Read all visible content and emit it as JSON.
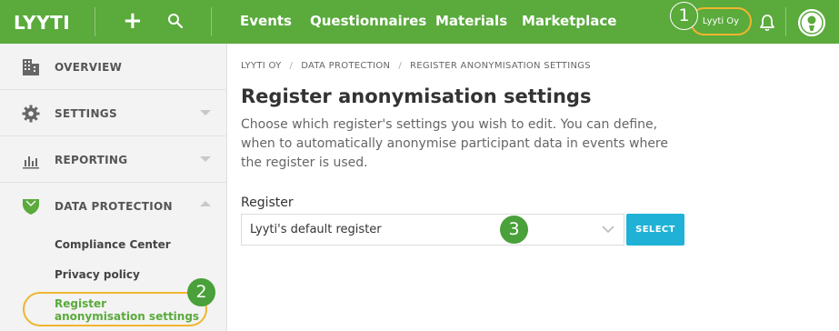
{
  "brand": {
    "logo": "LYYTI",
    "accent": "#5aaa3c",
    "highlight": "#f0b52e",
    "button_color": "#20b2d6"
  },
  "topnav": {
    "items": [
      {
        "label": "Events"
      },
      {
        "label": "Questionnaires"
      },
      {
        "label": "Materials"
      },
      {
        "label": "Marketplace"
      }
    ],
    "organization": "Lyyti Oy",
    "icons": [
      "plus-icon",
      "search-icon",
      "bell-icon",
      "avatar-icon"
    ]
  },
  "markers": {
    "one": "1",
    "two": "2",
    "three": "3"
  },
  "sidebar": {
    "items": [
      {
        "label": "OVERVIEW",
        "icon": "building-icon"
      },
      {
        "label": "SETTINGS",
        "icon": "gear-icon"
      },
      {
        "label": "REPORTING",
        "icon": "bar-chart-icon"
      },
      {
        "label": "DATA PROTECTION",
        "icon": "shield-icon"
      }
    ],
    "subitems": [
      {
        "label": "Compliance Center"
      },
      {
        "label": "Privacy policy"
      },
      {
        "label": "Register anonymisation settings",
        "active": true
      }
    ]
  },
  "breadcrumb": [
    "LYYTI OY",
    "DATA PROTECTION",
    "REGISTER ANONYMISATION SETTINGS"
  ],
  "main": {
    "title": "Register anonymisation settings",
    "description": "Choose which register's settings you wish to edit. You can define, when to automatically anonymise participant data in events where the register is used.",
    "register_label": "Register",
    "register_value": "Lyyti's default register",
    "select_button": "SELECT"
  }
}
